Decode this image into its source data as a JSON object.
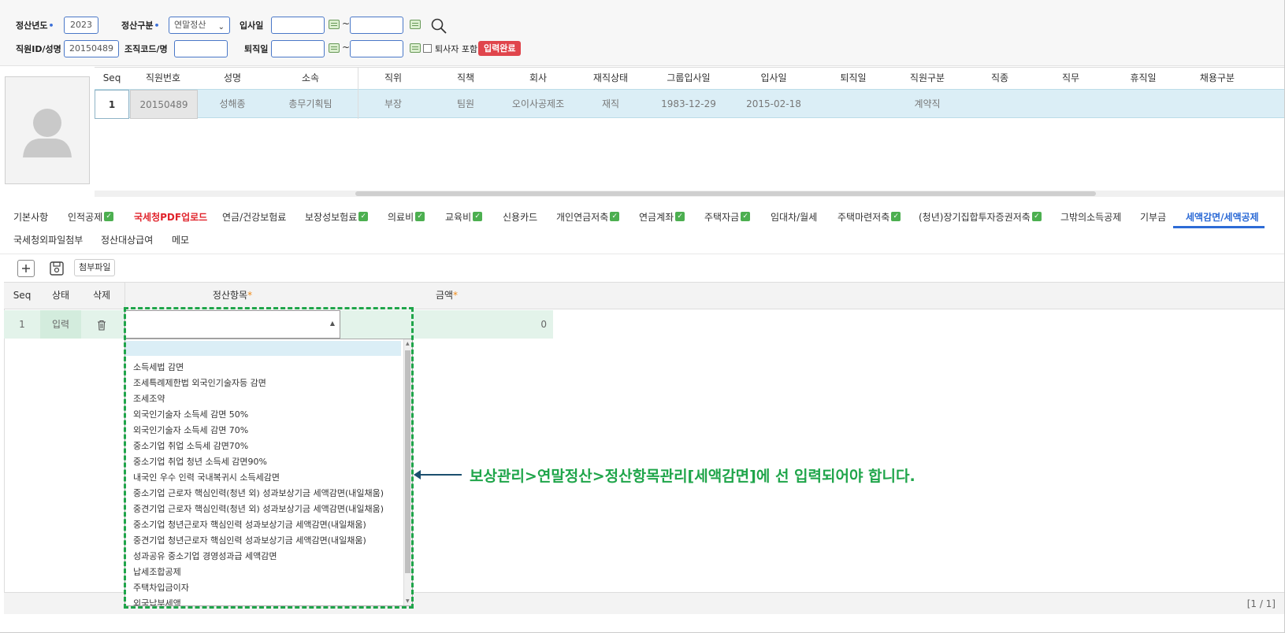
{
  "search": {
    "year_label": "정산년도",
    "year_value": "2023",
    "type_label": "정산구분",
    "type_value": "연말정산",
    "hire_label": "입사일",
    "hire_from": "",
    "hire_to": "",
    "tilde": "~",
    "emp_label": "직원ID/성명",
    "emp_value": "20150489",
    "org_label": "조직코드/명",
    "org_value": "",
    "retire_label": "퇴직일",
    "retire_from": "",
    "retire_to": "",
    "include_retired_label": "퇴사자 포함",
    "status_badge": "입력완료"
  },
  "employee_grid": {
    "headers": [
      "Seq",
      "직원번호",
      "성명",
      "소속",
      "직위",
      "직책",
      "회사",
      "재직상태",
      "그룹입사일",
      "입사일",
      "퇴직일",
      "직원구분",
      "직종",
      "직무",
      "휴직일",
      "채용구분"
    ],
    "row": {
      "seq": "1",
      "emp_no": "20150489",
      "name": "성해종",
      "dept": "총무기획팀",
      "position": "부장",
      "title": "팀원",
      "company": "오이사공제조",
      "status": "재직",
      "group_hire": "1983-12-29",
      "hire": "2015-02-18",
      "retire": "",
      "emp_type": "계약직"
    }
  },
  "tabs": [
    {
      "label": "기본사항",
      "check": false
    },
    {
      "label": "인적공제",
      "check": true
    },
    {
      "label": "국세청PDF업로드",
      "check": false,
      "style": "red"
    },
    {
      "label": "연금/건강보험료",
      "check": false
    },
    {
      "label": "보장성보험료",
      "check": true
    },
    {
      "label": "의료비",
      "check": true
    },
    {
      "label": "교육비",
      "check": true
    },
    {
      "label": "신용카드",
      "check": false
    },
    {
      "label": "개인연금저축",
      "check": true
    },
    {
      "label": "연금계좌",
      "check": true
    },
    {
      "label": "주택자금",
      "check": true
    },
    {
      "label": "임대차/월세",
      "check": false
    },
    {
      "label": "주택마련저축",
      "check": true
    },
    {
      "label": "(청년)장기집합투자증권저축",
      "check": true
    },
    {
      "label": "그밖의소득공제",
      "check": false
    },
    {
      "label": "기부금",
      "check": false
    },
    {
      "label": "세액감면/세액공제",
      "check": false,
      "style": "active"
    },
    {
      "label": "국세청외파일첨부",
      "check": false
    },
    {
      "label": "정산대상급여",
      "check": false
    },
    {
      "label": "메모",
      "check": false
    }
  ],
  "toolbar": {
    "add_icon": "plus-square-icon",
    "save_icon": "floppy-disk-icon",
    "attach_label": "첨부파일"
  },
  "detail_grid": {
    "headers": {
      "seq": "Seq",
      "state": "상태",
      "delete": "삭제",
      "item": "정산항목",
      "amount": "금액"
    },
    "row": {
      "seq": "1",
      "state": "입력",
      "item": "",
      "amount": "0"
    },
    "pager": "[1 / 1]"
  },
  "dropdown_options": [
    "",
    "소득세법 감면",
    "조세특례제한법 외국인기술자등 감면",
    "조세조약",
    "외국인기술자 소득세 감면 50%",
    "외국인기술자 소득세 감면 70%",
    "중소기업 취업 소득세 감면70%",
    "중소기업 취업 청년 소득세 감면90%",
    "내국인 우수 인력 국내복귀시 소득세감면",
    "중소기업 근로자 핵심인력(청년 외) 성과보상기금 세액감면(내일채움)",
    "중견기업 근로자 핵심인력(청년 외) 성과보상기금 세액감면(내일채움)",
    "중소기업 청년근로자 핵심인력 성과보상기금 세액감면(내일채움)",
    "중견기업 청년근로자 핵심인력 성과보상기금 세액감면(내일채움)",
    "성과공유 중소기업 경영성과급 세액감면",
    "납세조합공제",
    "주택차입금이자",
    "외국납부세액"
  ],
  "annotation": "보상관리>연말정산>정산항목관리[세액감면]에 선 입력되어야 합니다.",
  "colors": {
    "accent_blue": "#2d6bd6",
    "annotation_green": "#1fa54a",
    "badge_red": "#e0454c",
    "selected_row": "#dbeef6"
  }
}
